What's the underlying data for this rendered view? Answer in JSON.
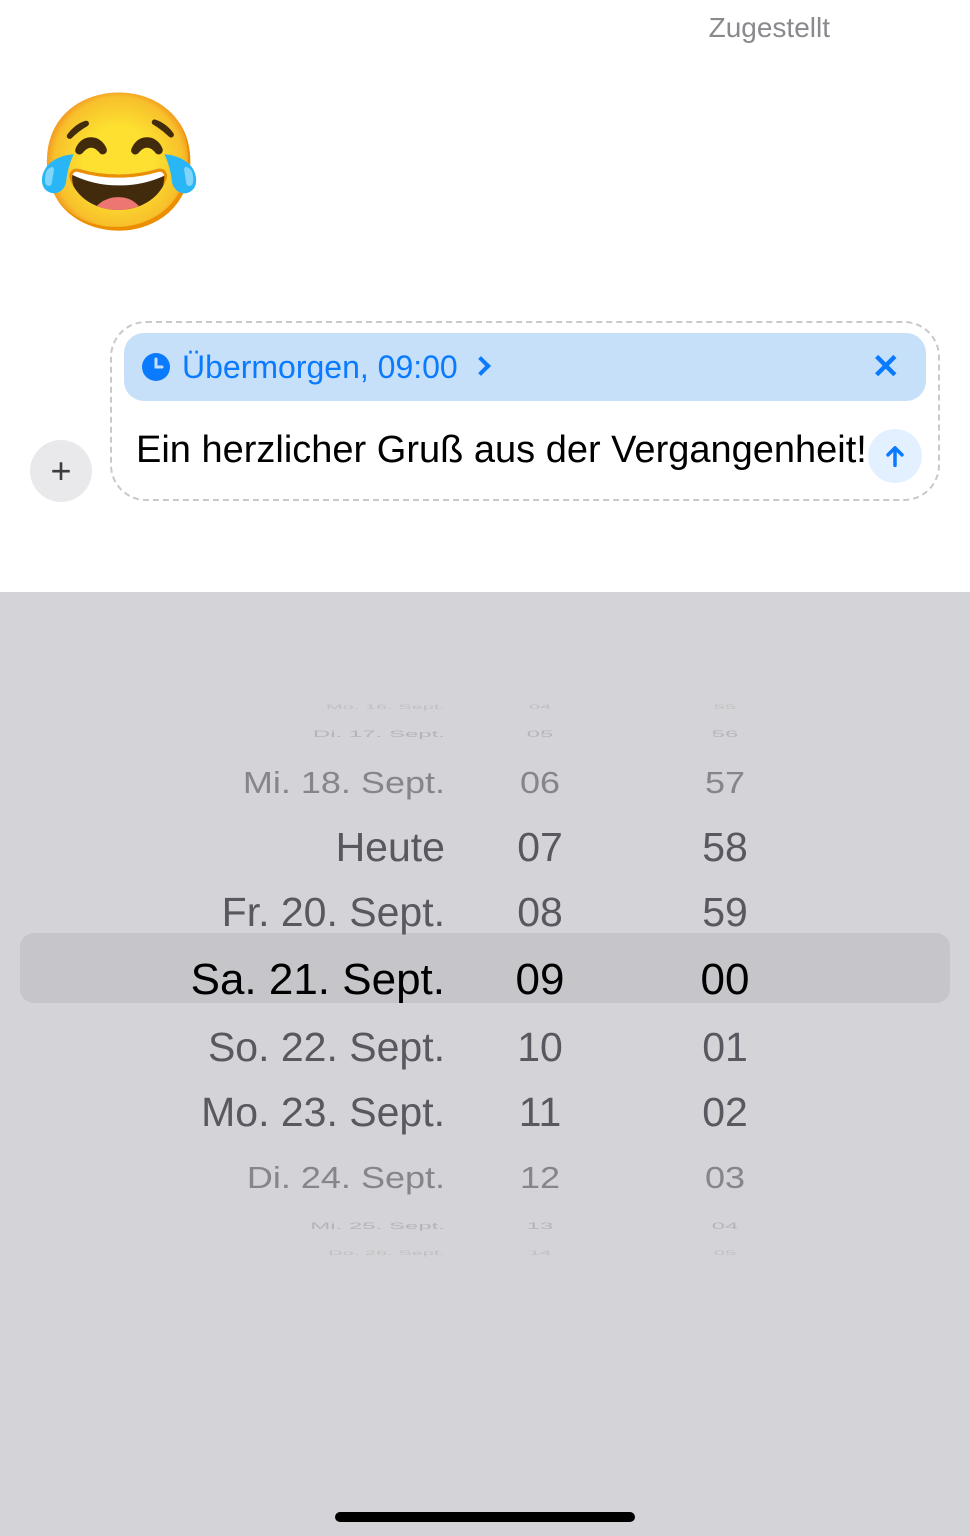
{
  "delivered_label": "Zugestellt",
  "emoji": "😂",
  "compose": {
    "schedule_text": "Übermorgen, 09:00",
    "message": "Ein herzlicher Gruß aus der Vergangenheit!"
  },
  "picker": {
    "dates": {
      "far_up2": "Mo. 16. Sept.",
      "far_up1": "Di. 17. Sept.",
      "up3": "Mi. 18. Sept.",
      "up2": "Heute",
      "up1": "Fr. 20. Sept.",
      "sel": "Sa. 21. Sept.",
      "dn1": "So. 22. Sept.",
      "dn2": "Mo. 23. Sept.",
      "dn3": "Di. 24. Sept.",
      "far_dn1": "Mi. 25. Sept.",
      "far_dn2": "Do. 26. Sept."
    },
    "hours": {
      "far_up2": "04",
      "far_up1": "05",
      "up3": "06",
      "up2": "07",
      "up1": "08",
      "sel": "09",
      "dn1": "10",
      "dn2": "11",
      "dn3": "12",
      "far_dn1": "13",
      "far_dn2": "14"
    },
    "mins": {
      "far_up2": "55",
      "far_up1": "56",
      "up3": "57",
      "up2": "58",
      "up1": "59",
      "sel": "00",
      "dn1": "01",
      "dn2": "02",
      "dn3": "03",
      "far_dn1": "04",
      "far_dn2": "05"
    }
  }
}
